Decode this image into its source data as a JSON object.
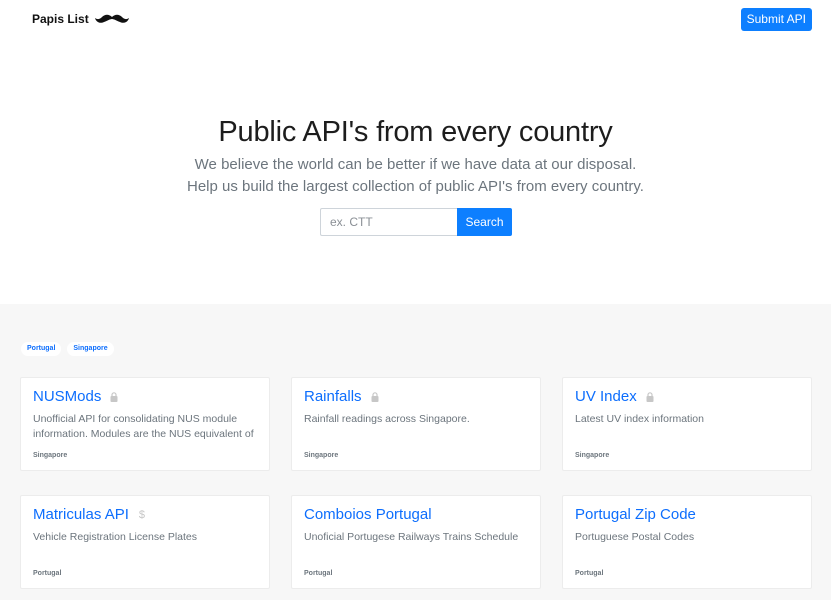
{
  "header": {
    "brand": "Papis List",
    "submit_label": "Submit API"
  },
  "hero": {
    "title": "Public API's from every country",
    "subtitle_line1": "We believe the world can be better if we have data at our disposal.",
    "subtitle_line2": "Help us build the largest collection of public API's from every country.",
    "search_placeholder": "ex. CTT",
    "search_label": "Search"
  },
  "filters": [
    "Portugal",
    "Singapore"
  ],
  "cards": [
    {
      "title": "NUSMods",
      "badge": "lock-icon",
      "description": "Unofficial API for consolidating NUS module information. Modules are the NUS equivalent of",
      "country": "Singapore"
    },
    {
      "title": "Rainfalls",
      "badge": "lock-icon",
      "description": "Rainfall readings across Singapore.",
      "country": "Singapore"
    },
    {
      "title": "UV Index",
      "badge": "lock-icon",
      "description": "Latest UV index information",
      "country": "Singapore"
    },
    {
      "title": "Matriculas API",
      "badge": "dollar-icon",
      "description": "Vehicle Registration License Plates",
      "country": "Portugal"
    },
    {
      "title": "Comboios Portugal",
      "badge": "",
      "description": "Unoficial Portugese Railways Trains Schedule",
      "country": "Portugal"
    },
    {
      "title": "Portugal Zip Code",
      "badge": "",
      "description": "Portuguese Postal Codes",
      "country": "Portugal"
    }
  ],
  "colors": {
    "accent": "#0d7fff",
    "link": "#0d6efd",
    "section_bg": "#f7f7f7",
    "muted_text": "#6c757d"
  }
}
